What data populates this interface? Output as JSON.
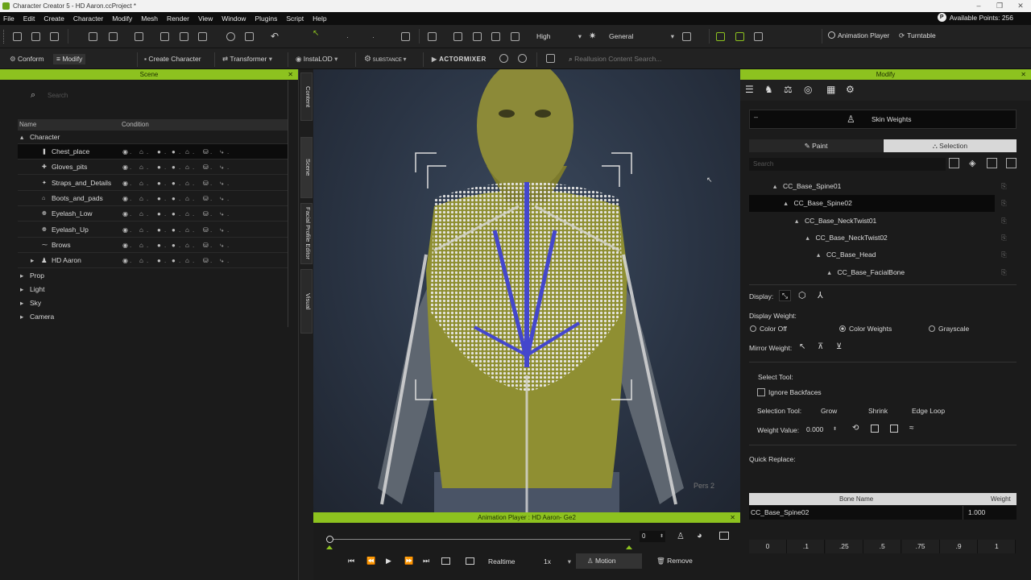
{
  "window": {
    "title": "Character Creator 5 - HD Aaron.ccProject *",
    "icon": "cc-app-icon"
  },
  "menu": [
    "File",
    "Edit",
    "Create",
    "Character",
    "Modify",
    "Mesh",
    "Render",
    "View",
    "Window",
    "Plugins",
    "Script",
    "Help"
  ],
  "points": {
    "label": "Available Points: 256"
  },
  "toolbar1": {
    "quality": "High",
    "lighting": "General",
    "animation_player": "Animation Player",
    "turntable": "Turntable"
  },
  "toolbar2": {
    "conform": "Conform",
    "modify": "Modify",
    "create_character": "Create Character",
    "transformer": "Transformer",
    "insta_lod": "InstaLOD",
    "substance": "SUBSTANCE",
    "actormixer": "ACTORMIXER",
    "search_placeholder": "Reallusion Content Search..."
  },
  "scene": {
    "title": "Scene",
    "search_placeholder": "Search",
    "col_name": "Name",
    "col_condition": "Condition",
    "character_group": "Character",
    "items": [
      "Chest_place",
      "Gloves_pits",
      "Straps_and_Details",
      "Boots_and_pads",
      "Eyelash_Low",
      "Eyelash_Up",
      "Brows",
      "HD Aaron"
    ],
    "groups": [
      "Prop",
      "Light",
      "Sky",
      "Camera"
    ]
  },
  "side_tabs": [
    "Content",
    "Scene",
    "Facial Profile Editor",
    "Visual"
  ],
  "viewport": {
    "camera_label": "Pers 2"
  },
  "anim_player": {
    "title": "Animation Player : HD Aaron- Ge2",
    "frame": "0",
    "realtime": "Realtime",
    "speed": "1x",
    "motion": "Motion",
    "remove": "Remove"
  },
  "modify": {
    "title": "Modify",
    "skin_weights": "Skin Weights",
    "paint_tab": "Paint",
    "selection_tab": "Selection",
    "search_placeholder": "Search",
    "bones": [
      "CC_Base_Spine01",
      "CC_Base_Spine02",
      "CC_Base_NeckTwist01",
      "CC_Base_NeckTwist02",
      "CC_Base_Head",
      "CC_Base_FacialBone"
    ],
    "display_label": "Display:",
    "display_weight_label": "Display Weight:",
    "color_off": "Color Off",
    "color_weights": "Color Weights",
    "grayscale": "Grayscale",
    "mirror_weight": "Mirror Weight:",
    "select_tool": "Select Tool:",
    "ignore_backfaces": "Ignore Backfaces",
    "selection_tool_label": "Selection Tool:",
    "grow": "Grow",
    "shrink": "Shrink",
    "edge_loop": "Edge Loop",
    "weight_value_label": "Weight Value:",
    "weight_value": "0.000",
    "quick_replace": "Quick Replace:",
    "quick_values": [
      "0",
      ".1",
      ".25",
      ".5",
      ".75",
      ".9",
      "1"
    ],
    "table_bone_header": "Bone Name",
    "table_weight_header": "Weight",
    "table_rows": [
      {
        "bone": "CC_Base_Spine02",
        "weight": "1.000"
      }
    ]
  },
  "colors": {
    "accent": "#8dc21f",
    "panel": "#1b1b1b",
    "selected": "#0c0c0c"
  }
}
